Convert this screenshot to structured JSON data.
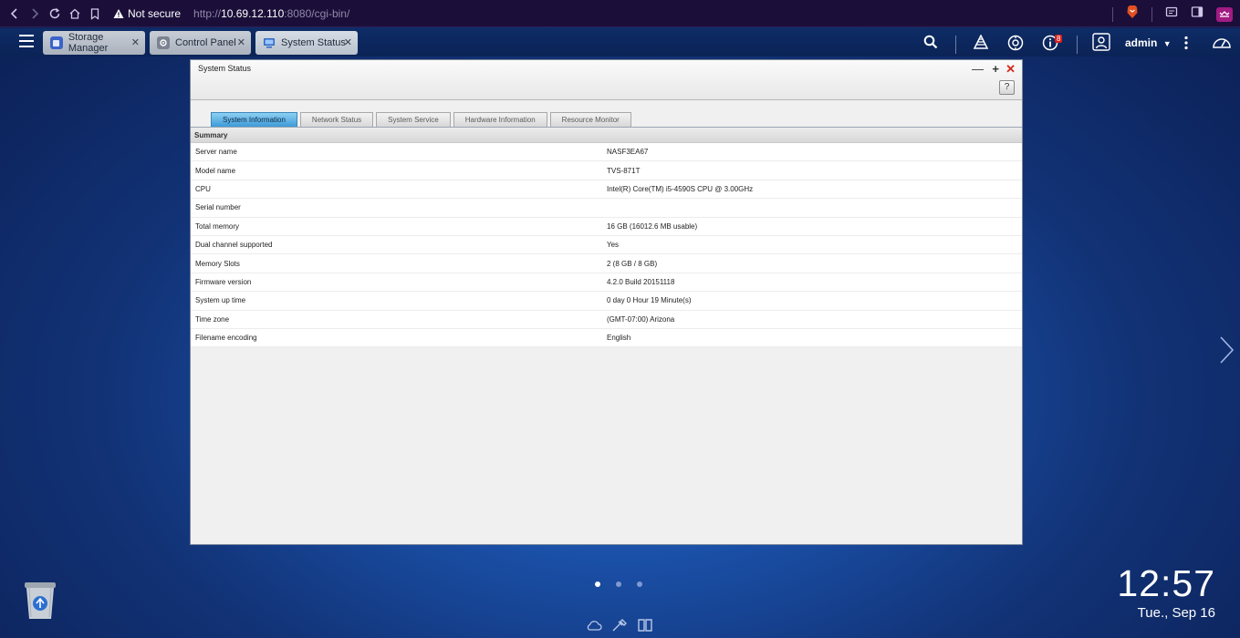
{
  "browser": {
    "security_label": "Not secure",
    "url_scheme": "http://",
    "url_host": "10.69.12.110",
    "url_rest": ":8080/cgi-bin/"
  },
  "taskbar": {
    "tabs": [
      {
        "label": "Storage Manager",
        "icon": "storage-manager-icon"
      },
      {
        "label": "Control Panel",
        "icon": "control-panel-icon"
      },
      {
        "label": "System Status",
        "icon": "system-status-icon"
      }
    ],
    "notification_count": "8",
    "user": "admin"
  },
  "window": {
    "title": "System Status",
    "help": "?",
    "tabs": [
      "System Information",
      "Network Status",
      "System Service",
      "Hardware Information",
      "Resource Monitor"
    ],
    "active_tab": "System Information",
    "section": "Summary",
    "rows": [
      {
        "label": "Server name",
        "value": "NASF3EA67"
      },
      {
        "label": "Model name",
        "value": "TVS-871T"
      },
      {
        "label": "CPU",
        "value": "Intel(R) Core(TM) i5-4590S CPU @ 3.00GHz"
      },
      {
        "label": "Serial number",
        "value": ""
      },
      {
        "label": "Total memory",
        "value": "16 GB (16012.6 MB usable)"
      },
      {
        "label": "Dual channel supported",
        "value": "Yes"
      },
      {
        "label": "Memory Slots",
        "value": "2 (8 GB / 8 GB)"
      },
      {
        "label": "Firmware version",
        "value": "4.2.0 Build 20151118"
      },
      {
        "label": "System up time",
        "value": "0 day 0 Hour 19 Minute(s)"
      },
      {
        "label": "Time zone",
        "value": "(GMT-07:00) Arizona"
      },
      {
        "label": "Filename encoding",
        "value": "English"
      }
    ]
  },
  "desktop": {
    "time": "12:57",
    "date": "Tue., Sep 16",
    "page_count": 3,
    "active_page": 1
  }
}
